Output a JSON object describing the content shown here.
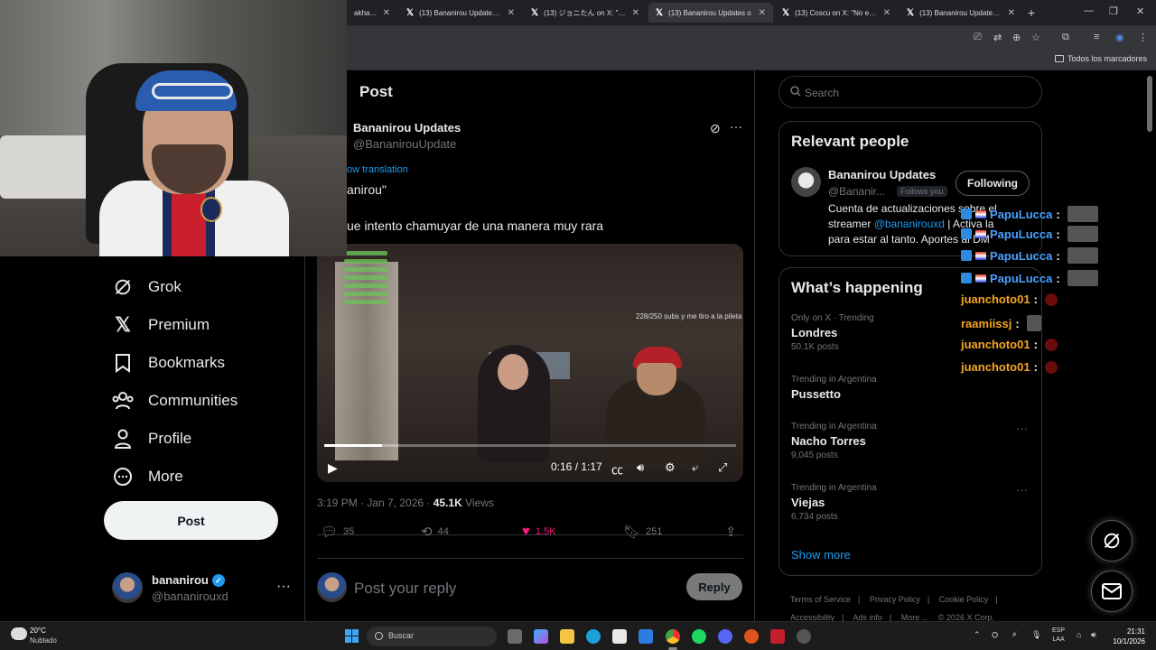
{
  "browser": {
    "tabs": [
      {
        "title": "akhalifa)",
        "active": false
      },
      {
        "title": "(13) Bananirou Updates o",
        "active": false
      },
      {
        "title": "(13) ジョニたん on X: \"@Ba",
        "active": false
      },
      {
        "title": "(13) Bananirou Updates o",
        "active": true
      },
      {
        "title": "(13) Coscu on X: \"No está",
        "active": false
      },
      {
        "title": "(13) Bananirou Updates o",
        "active": false
      }
    ],
    "new_tab": "+",
    "bookmarks_all": "Todos los marcadores"
  },
  "nav": {
    "items": [
      {
        "label": "Grok",
        "icon": "grok-icon"
      },
      {
        "label": "Premium",
        "icon": "x-logo-icon"
      },
      {
        "label": "Bookmarks",
        "icon": "bookmark-icon"
      },
      {
        "label": "Communities",
        "icon": "communities-icon"
      },
      {
        "label": "Profile",
        "icon": "profile-icon"
      },
      {
        "label": "More",
        "icon": "more-circle-icon"
      }
    ],
    "post_button": "Post",
    "account": {
      "name": "bananirou",
      "handle": "@bananirouxd"
    }
  },
  "post": {
    "header": "Post",
    "author_name": "Bananirou Updates",
    "author_handle": "@BananirouUpdate",
    "translation_link": "ow translation",
    "line1": "anirou\"",
    "line2": "ue intento chamuyar de una manera muy rara",
    "video": {
      "time": "0:16 / 1:17",
      "progress": 0.14,
      "overlay_subs": "228/250 subs y me tiro a la pileta"
    },
    "meta_time": "3:19 PM · Jan 7, 2026 · ",
    "views_count": "45.1K",
    "views_label": " Views",
    "actions": {
      "replies": "35",
      "reposts": "44",
      "likes": "1.5K",
      "bookmarks": "251"
    },
    "reply_placeholder": "Post your reply",
    "reply_button": "Reply"
  },
  "sidebar": {
    "search_placeholder": "Search",
    "relevant_people": {
      "title": "Relevant people",
      "name": "Bananirou Updates",
      "handle": "@Bananir...",
      "follows_you": "Follows you",
      "button": "Following",
      "bio_part1": "Cuenta de actualizaciones sobre el streamer ",
      "bio_mention": "@bananirouxd",
      "bio_part2": " | Activa la  para estar al tanto. Aportes al DM"
    },
    "whats_happening": {
      "title": "What’s happening",
      "trends": [
        {
          "meta": "Only on X · Trending",
          "name": "Londres",
          "count": "50.1K posts"
        },
        {
          "meta": "Trending in Argentina",
          "name": "Pussetto",
          "count": ""
        },
        {
          "meta": "Trending in Argentina",
          "name": "Nacho Torres",
          "count": "9,045 posts"
        },
        {
          "meta": "Trending in Argentina",
          "name": "Viejas",
          "count": "6,734 posts"
        }
      ],
      "show_more": "Show more"
    },
    "footer": [
      "Terms of Service",
      "Privacy Policy",
      "Cookie Policy",
      "Accessibility",
      "Ads info",
      "More ...",
      "© 2026 X Corp."
    ]
  },
  "chat_overlay": [
    {
      "user": "PapuLucca",
      "color": "blue"
    },
    {
      "user": "PapuLucca",
      "color": "blue"
    },
    {
      "user": "PapuLucca",
      "color": "blue"
    },
    {
      "user": "PapuLucca",
      "color": "blue"
    },
    {
      "user": "juanchoto01",
      "color": "orange"
    },
    {
      "user": "raamiissj",
      "color": "orange"
    },
    {
      "user": "juanchoto01",
      "color": "orange"
    },
    {
      "user": "juanchoto01",
      "color": "orange"
    }
  ],
  "taskbar": {
    "weather_temp": "20°C",
    "weather_desc": "Nublado",
    "search": "Buscar",
    "lang1": "ESP",
    "lang2": "LAA",
    "time": "21:31",
    "date": "10/1/2026"
  },
  "colors": {
    "accent": "#1d9bf0",
    "like": "#f91880",
    "background": "#000000"
  }
}
